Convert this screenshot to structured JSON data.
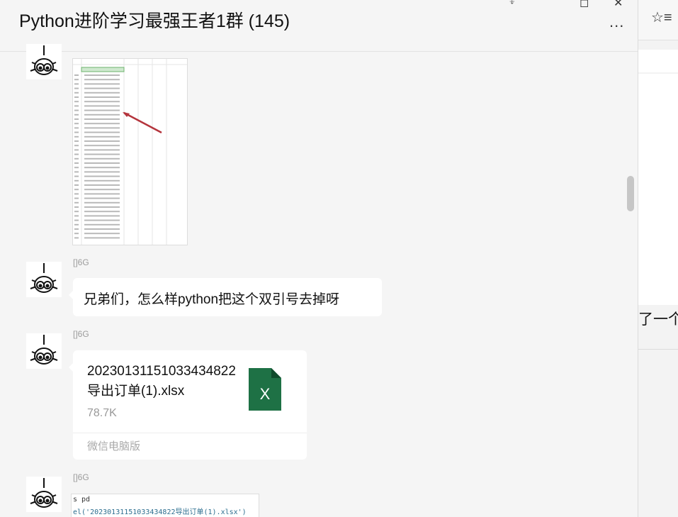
{
  "chat": {
    "title": "Python进阶学习最强王者1群 (145)",
    "more_label": "...",
    "window_controls": [
      "pin-icon",
      "maximize-icon",
      "close-icon"
    ],
    "messages": [
      {
        "type": "image",
        "content": "spreadsheet-screenshot"
      },
      {
        "sender": "\u0000\u0006G",
        "type": "text",
        "text": "兄弟们，怎么样python把这个双引号去掉呀"
      },
      {
        "sender": "\u0000\u0006G",
        "type": "file",
        "file_name": "20230131151033434822导出订单(1).xlsx",
        "file_size": "78.7K",
        "source": "微信电脑版",
        "icon": "excel-icon"
      },
      {
        "sender": "\u0000\u0006G",
        "type": "image",
        "code_lines": [
          "s pd",
          "el('20230131151033434822导出订单(1).xlsx')"
        ]
      }
    ]
  },
  "sender_labels": [
    "[]6G",
    "[]6G",
    "[]6G"
  ],
  "right_panel": {
    "fav_icon": "favorites-icon",
    "partial_text": "了一个"
  },
  "colors": {
    "excel_green": "#1e7145",
    "chat_bg": "#f5f5f5",
    "bubble_bg": "#ffffff"
  }
}
